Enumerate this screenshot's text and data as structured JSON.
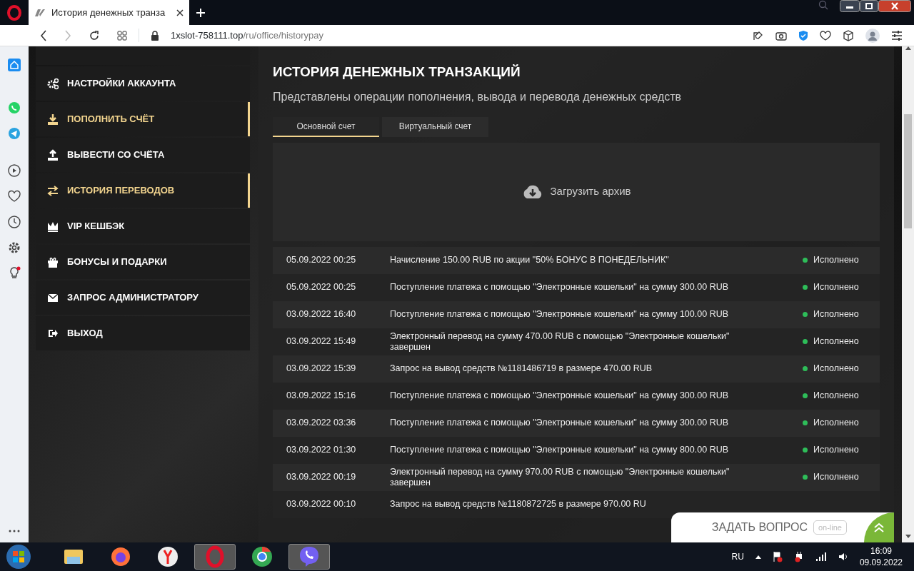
{
  "browser": {
    "tab_title": "История денежных транза",
    "url_host": "1xslot-758111.top",
    "url_path": "/ru/office/historypay"
  },
  "sidebar": {
    "items": [
      {
        "label": "НАСТРОЙКИ АККАУНТА",
        "selected": false
      },
      {
        "label": "ПОПОЛНИТЬ СЧЁТ",
        "selected": true
      },
      {
        "label": "ВЫВЕСТИ СО СЧЁТА",
        "selected": false
      },
      {
        "label": "ИСТОРИЯ ПЕРЕВОДОВ",
        "selected": true
      },
      {
        "label": "VIP КЕШБЭК",
        "selected": false
      },
      {
        "label": "БОНУСЫ И ПОДАРКИ",
        "selected": false
      },
      {
        "label": "ЗАПРОС АДМИНИСТРАТОРУ",
        "selected": false
      },
      {
        "label": "ВЫХОД",
        "selected": false
      }
    ]
  },
  "page": {
    "title": "ИСТОРИЯ ДЕНЕЖНЫХ ТРАНЗАКЦИЙ",
    "subtitle": "Представлены операции пополнения, вывода и перевода денежных средств",
    "tabs": [
      {
        "label": "Основной счет",
        "selected": true
      },
      {
        "label": "Виртуальный счет",
        "selected": false
      }
    ],
    "archive_button": "Загрузить архив",
    "transactions": [
      {
        "date": "05.09.2022 00:25",
        "description": "Начисление 150.00 RUB по акции \"50% БОНУС В ПОНЕДЕЛЬНИК\"",
        "status": "Исполнено"
      },
      {
        "date": "05.09.2022 00:25",
        "description": "Поступление платежа с помощью \"Электронные кошельки\" на сумму 300.00 RUB",
        "status": "Исполнено"
      },
      {
        "date": "03.09.2022 16:40",
        "description": "Поступление платежа с помощью \"Электронные кошельки\" на сумму 100.00 RUB",
        "status": "Исполнено"
      },
      {
        "date": "03.09.2022 15:49",
        "description": "Электронный перевод на сумму 470.00 RUB с помощью \"Электронные кошельки\" завершен",
        "status": "Исполнено"
      },
      {
        "date": "03.09.2022 15:39",
        "description": "Запрос на вывод средств №1181486719 в размере 470.00 RUB",
        "status": "Исполнено"
      },
      {
        "date": "03.09.2022 15:16",
        "description": "Поступление платежа с помощью \"Электронные кошельки\" на сумму 300.00 RUB",
        "status": "Исполнено"
      },
      {
        "date": "03.09.2022 03:36",
        "description": "Поступление платежа с помощью \"Электронные кошельки\" на сумму 300.00 RUB",
        "status": "Исполнено"
      },
      {
        "date": "03.09.2022 01:30",
        "description": "Поступление платежа с помощью \"Электронные кошельки\" на сумму 800.00 RUB",
        "status": "Исполнено"
      },
      {
        "date": "03.09.2022 00:19",
        "description": "Электронный перевод на сумму 970.00 RUB с помощью \"Электронные кошельки\" завершен",
        "status": "Исполнено"
      },
      {
        "date": "03.09.2022 00:10",
        "description": "Запрос на вывод средств №1180872725 в размере 970.00 RU"
      }
    ],
    "chat": {
      "label": "ЗАДАТЬ ВОПРОС",
      "badge": "on-line"
    }
  },
  "taskbar": {
    "language": "RU",
    "time": "16:09",
    "date": "09.09.2022"
  }
}
